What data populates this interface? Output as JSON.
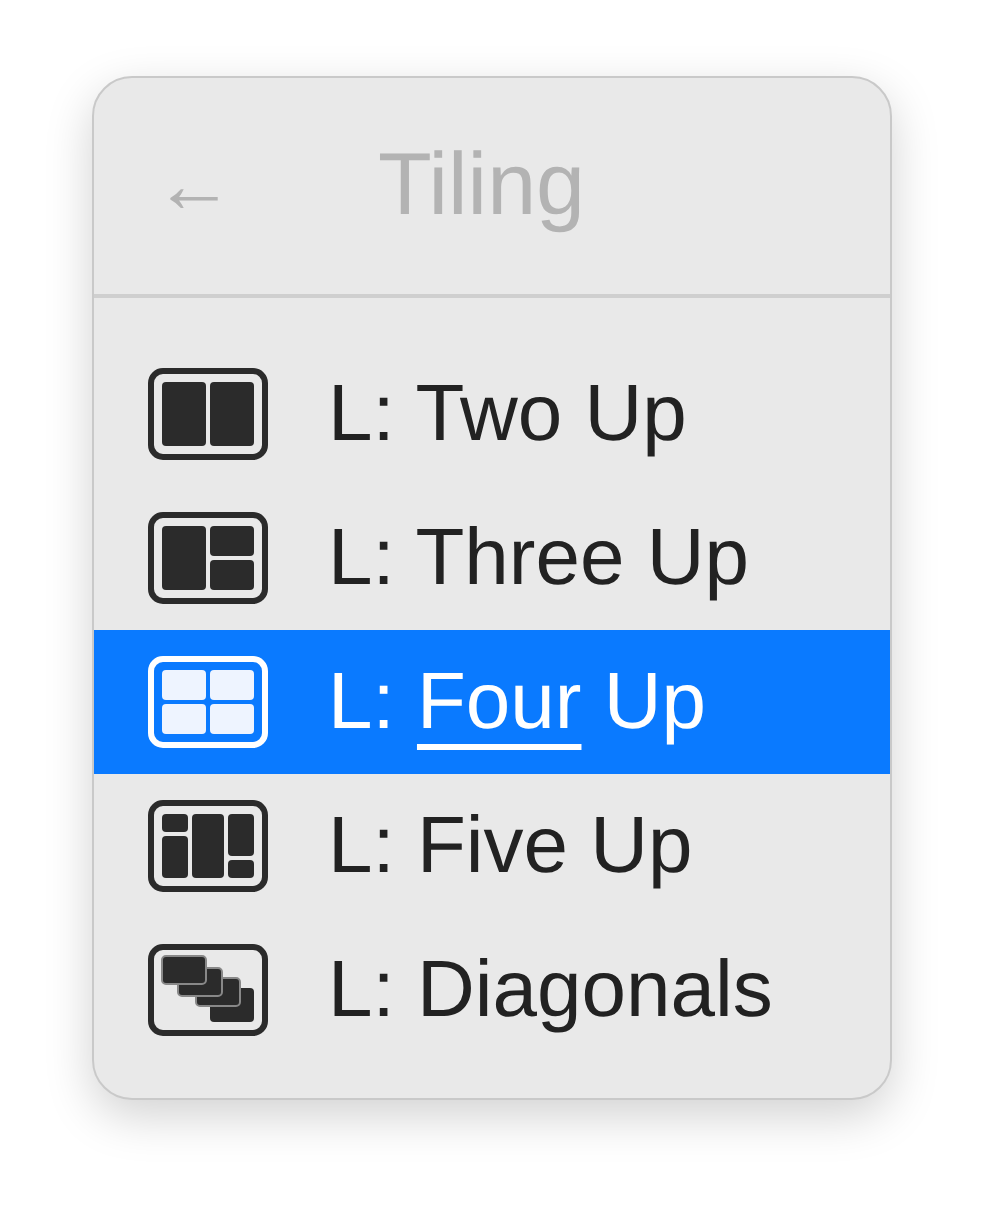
{
  "header": {
    "back": "←",
    "title": "Tiling"
  },
  "items": [
    {
      "kind": "two",
      "selected": false,
      "label_parts": [
        {
          "text": "L: Two Up",
          "underlined": false
        }
      ]
    },
    {
      "kind": "three",
      "selected": false,
      "label_parts": [
        {
          "text": "L: Three Up",
          "underlined": false
        }
      ]
    },
    {
      "kind": "four",
      "selected": true,
      "label_parts": [
        {
          "text": "L: ",
          "underlined": false
        },
        {
          "text": "Four",
          "underlined": true
        },
        {
          "text": " Up",
          "underlined": false
        }
      ]
    },
    {
      "kind": "five",
      "selected": false,
      "label_parts": [
        {
          "text": "L: Five Up",
          "underlined": false
        }
      ]
    },
    {
      "kind": "diagonals",
      "selected": false,
      "label_parts": [
        {
          "text": "L: Diagonals",
          "underlined": false
        }
      ]
    }
  ]
}
